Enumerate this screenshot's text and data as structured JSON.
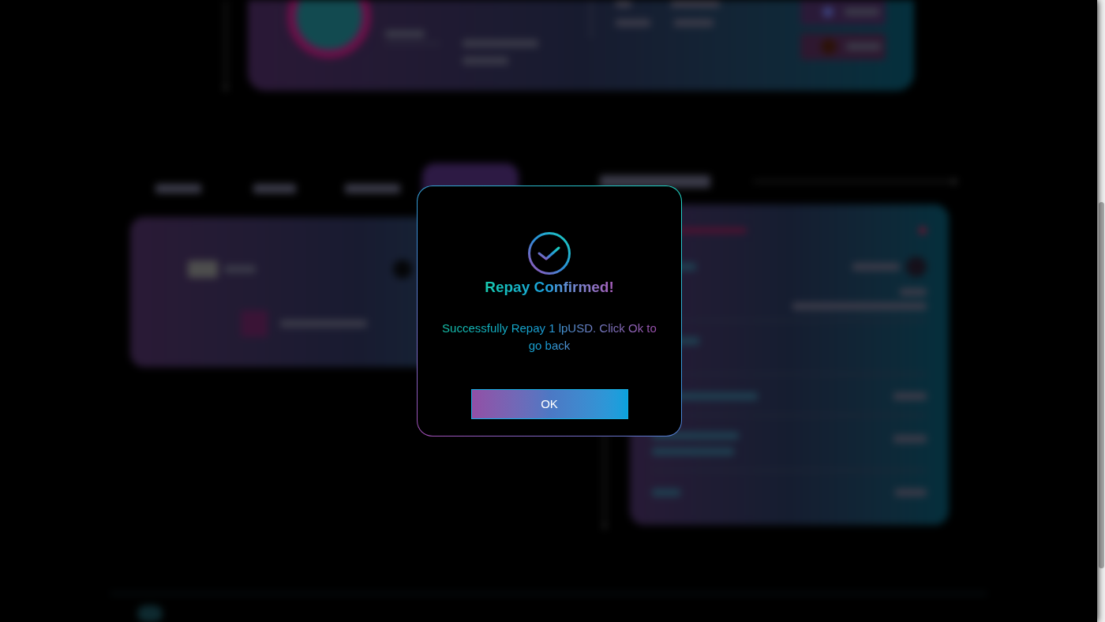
{
  "dialog": {
    "title": "Repay Confirmed!",
    "message": "Successfully Repay 1 lpUSD. Click Ok to go back",
    "button": "OK"
  }
}
